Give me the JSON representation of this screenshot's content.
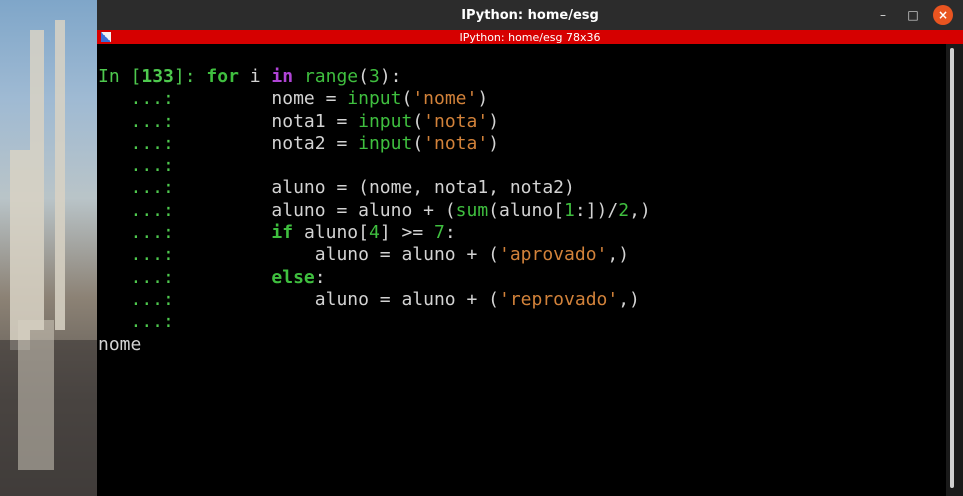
{
  "window": {
    "title": "IPython: home/esg",
    "terminal_header": "IPython: home/esg 78x36",
    "controls": {
      "minimize": "–",
      "maximize": "□",
      "close": "×"
    }
  },
  "prompt": {
    "in_label": "In [",
    "number": "133",
    "in_close": "]: ",
    "continuation": "   ...: "
  },
  "code_lines": [
    {
      "indent": "",
      "tokens": [
        [
          "kw",
          "for"
        ],
        [
          "w",
          " i "
        ],
        [
          "kwp",
          "in"
        ],
        [
          "w",
          " "
        ],
        [
          "fn",
          "range"
        ],
        [
          "w",
          "("
        ],
        [
          "num",
          "3"
        ],
        [
          "w",
          "):"
        ]
      ]
    },
    {
      "indent": "    ",
      "tokens": [
        [
          "w",
          "nome = "
        ],
        [
          "fn",
          "input"
        ],
        [
          "w",
          "("
        ],
        [
          "str",
          "'nome'"
        ],
        [
          "w",
          ")"
        ]
      ]
    },
    {
      "indent": "    ",
      "tokens": [
        [
          "w",
          "nota1 = "
        ],
        [
          "fn",
          "input"
        ],
        [
          "w",
          "("
        ],
        [
          "str",
          "'nota'"
        ],
        [
          "w",
          ")"
        ]
      ]
    },
    {
      "indent": "    ",
      "tokens": [
        [
          "w",
          "nota2 = "
        ],
        [
          "fn",
          "input"
        ],
        [
          "w",
          "("
        ],
        [
          "str",
          "'nota'"
        ],
        [
          "w",
          ")"
        ]
      ]
    },
    {
      "indent": "",
      "tokens": []
    },
    {
      "indent": "    ",
      "tokens": [
        [
          "w",
          "aluno = (nome, nota1, nota2)"
        ]
      ]
    },
    {
      "indent": "    ",
      "tokens": [
        [
          "w",
          "aluno = aluno + ("
        ],
        [
          "fn",
          "sum"
        ],
        [
          "w",
          "(aluno["
        ],
        [
          "num",
          "1"
        ],
        [
          "w",
          ":])/"
        ],
        [
          "num",
          "2"
        ],
        [
          "w",
          ",)"
        ]
      ]
    },
    {
      "indent": "    ",
      "tokens": [
        [
          "kw",
          "if"
        ],
        [
          "w",
          " aluno["
        ],
        [
          "num",
          "4"
        ],
        [
          "w",
          "] >= "
        ],
        [
          "num",
          "7"
        ],
        [
          "w",
          ":"
        ]
      ]
    },
    {
      "indent": "        ",
      "tokens": [
        [
          "w",
          "aluno = aluno + ("
        ],
        [
          "str",
          "'aprovado'"
        ],
        [
          "w",
          ",)"
        ]
      ]
    },
    {
      "indent": "    ",
      "tokens": [
        [
          "kw",
          "else"
        ],
        [
          "w",
          ":"
        ]
      ]
    },
    {
      "indent": "        ",
      "tokens": [
        [
          "w",
          "aluno = aluno + ("
        ],
        [
          "str",
          "'reprovado'"
        ],
        [
          "w",
          ",)"
        ]
      ]
    },
    {
      "indent": "",
      "tokens": []
    }
  ],
  "output": "nome",
  "colors": {
    "header_red": "#d60000",
    "prompt_green": "#4ec94e",
    "keyword_purple": "#b044d6",
    "string_orange": "#d2823a",
    "close_orange": "#e95420"
  },
  "icons": {
    "terminal": "terminal-app-icon"
  }
}
